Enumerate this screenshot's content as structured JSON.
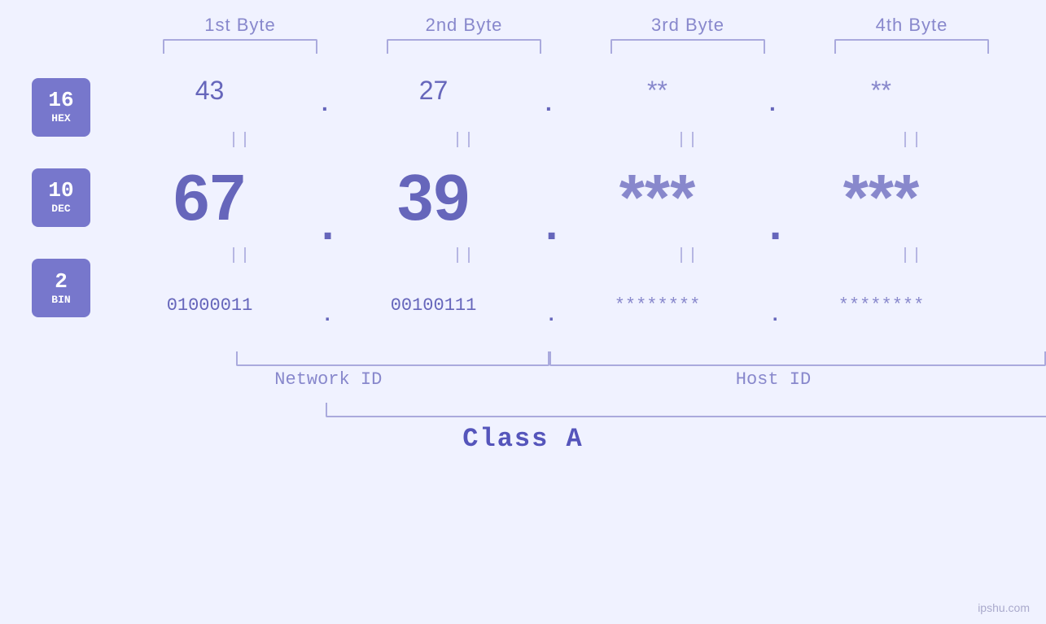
{
  "header": {
    "byte1": "1st Byte",
    "byte2": "2nd Byte",
    "byte3": "3rd Byte",
    "byte4": "4th Byte"
  },
  "badges": {
    "hex": {
      "num": "16",
      "label": "HEX"
    },
    "dec": {
      "num": "10",
      "label": "DEC"
    },
    "bin": {
      "num": "2",
      "label": "BIN"
    }
  },
  "hex_row": {
    "b1": "43",
    "b2": "27",
    "b3": "**",
    "b4": "**"
  },
  "dec_row": {
    "b1": "67",
    "b2": "39",
    "b3": "***",
    "b4": "***"
  },
  "bin_row": {
    "b1": "01000011",
    "b2": "00100111",
    "b3": "********",
    "b4": "********"
  },
  "labels": {
    "network_id": "Network ID",
    "host_id": "Host ID",
    "class": "Class A"
  },
  "watermark": "ipshu.com",
  "equals": "||"
}
